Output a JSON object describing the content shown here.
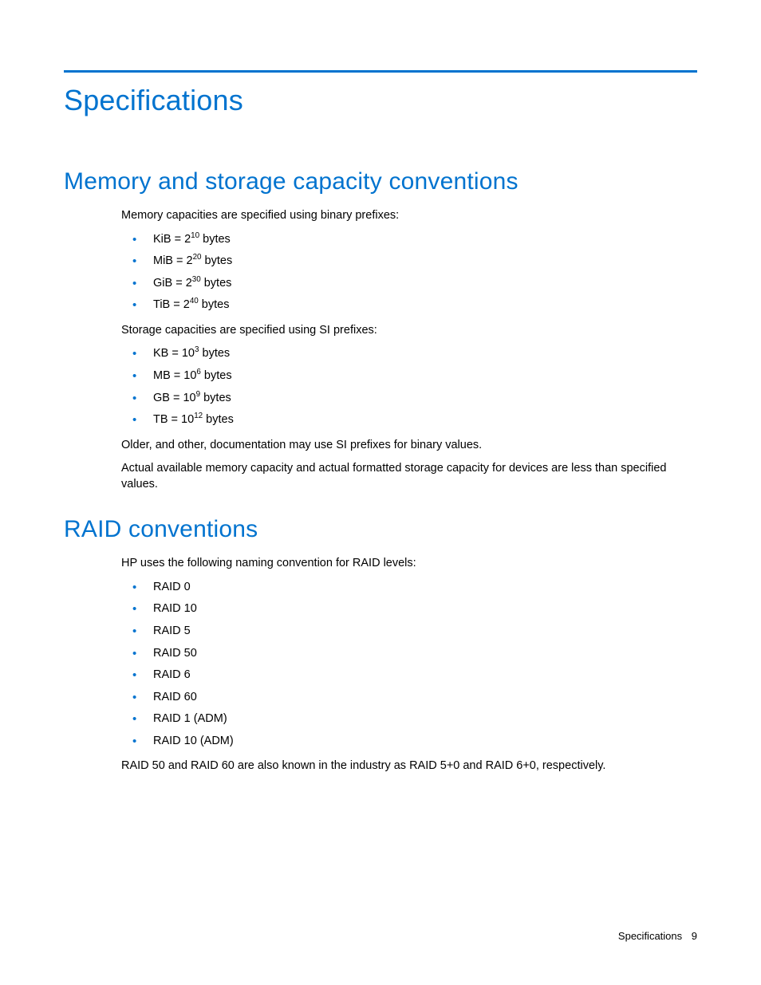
{
  "title": "Specifications",
  "section1": {
    "heading": "Memory and storage capacity conventions",
    "intro": "Memory capacities are specified using binary prefixes:",
    "binary_prefixes": [
      {
        "unit": "KiB",
        "base": "2",
        "exp": "10",
        "suffix": " bytes"
      },
      {
        "unit": "MiB",
        "base": "2",
        "exp": "20",
        "suffix": " bytes"
      },
      {
        "unit": "GiB",
        "base": "2",
        "exp": "30",
        "suffix": " bytes"
      },
      {
        "unit": "TiB",
        "base": "2",
        "exp": "40",
        "suffix": " bytes"
      }
    ],
    "si_intro": "Storage capacities are specified using SI prefixes:",
    "si_prefixes": [
      {
        "unit": "KB",
        "base": "10",
        "exp": "3",
        "suffix": " bytes"
      },
      {
        "unit": "MB",
        "base": "10",
        "exp": "6",
        "suffix": " bytes"
      },
      {
        "unit": "GB",
        "base": "10",
        "exp": "9",
        "suffix": " bytes"
      },
      {
        "unit": "TB",
        "base": "10",
        "exp": "12",
        "suffix": " bytes"
      }
    ],
    "note1": "Older, and other, documentation may use SI prefixes for binary values.",
    "note2": "Actual available memory capacity and actual formatted storage capacity for devices are less than specified values."
  },
  "section2": {
    "heading": "RAID conventions",
    "intro": "HP uses the following naming convention for RAID levels:",
    "levels": [
      "RAID 0",
      "RAID 10",
      "RAID 5",
      "RAID 50",
      "RAID 6",
      "RAID 60",
      "RAID 1 (ADM)",
      "RAID 10 (ADM)"
    ],
    "closing": "RAID 50 and RAID 60 are also known in the industry as RAID 5+0 and RAID 6+0, respectively."
  },
  "footer": {
    "label": "Specifications",
    "page": "9"
  }
}
